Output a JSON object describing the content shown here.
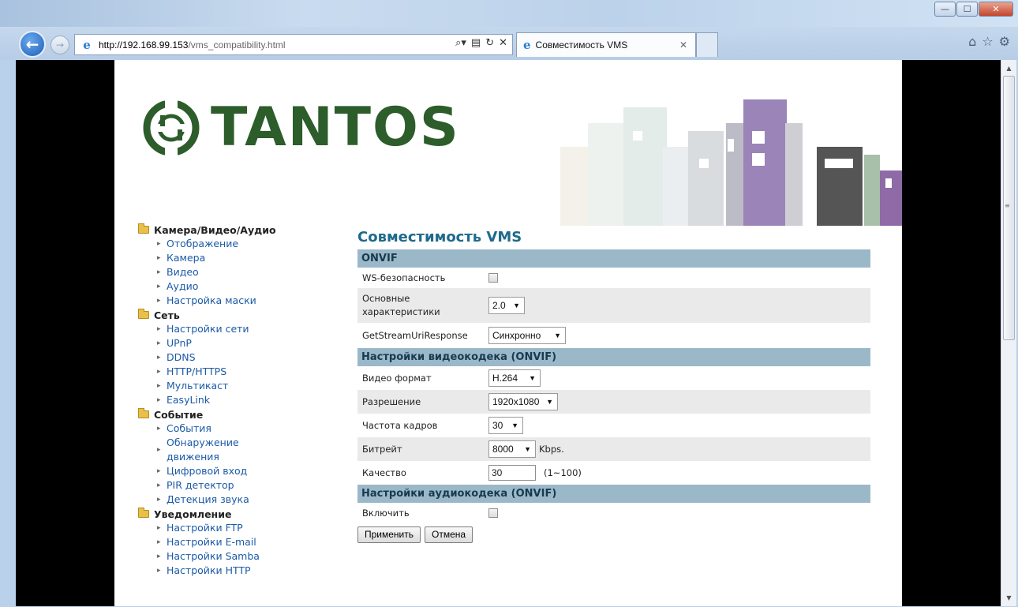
{
  "browser": {
    "url_host": "http://192.168.99.153",
    "url_path": "/vms_compatibility.html",
    "tab_title": "Совместимость VMS"
  },
  "brand": {
    "name": "TANTOS",
    "color": "#2c5d2a"
  },
  "sidebar": {
    "sections": [
      {
        "title": "Камера/Видео/Аудио",
        "items": [
          "Отображение",
          "Камера",
          "Видео",
          "Аудио",
          "Настройка маски"
        ]
      },
      {
        "title": "Сеть",
        "items": [
          "Настройки сети",
          "UPnP",
          "DDNS",
          "HTTP/HTTPS",
          "Мультикаст",
          "EasyLink"
        ]
      },
      {
        "title": "Событие",
        "items": [
          "События",
          "Обнаружение движения",
          "Цифровой вход",
          "PIR детектор",
          "Детекция звука"
        ]
      },
      {
        "title": "Уведомление",
        "items": [
          "Настройки FTP",
          "Настройки E-mail",
          "Настройки Samba",
          "Настройки HTTP"
        ]
      }
    ]
  },
  "page": {
    "title": "Совместимость VMS",
    "onvif": {
      "header": "ONVIF",
      "ws_security_label": "WS-безопасность",
      "main_features_label": "Основные характеристики",
      "main_features_value": "2.0",
      "getstream_label": "GetStreamUriResponse",
      "getstream_value": "Синхронно"
    },
    "video": {
      "header": "Настройки видеокодека (ONVIF)",
      "format_label": "Видео формат",
      "format_value": "H.264",
      "resolution_label": "Разрешение",
      "resolution_value": "1920x1080",
      "fps_label": "Частота кадров",
      "fps_value": "30",
      "bitrate_label": "Битрейт",
      "bitrate_value": "8000",
      "bitrate_unit": "Kbps.",
      "quality_label": "Качество",
      "quality_value": "30",
      "quality_range": "(1~100)"
    },
    "audio": {
      "header": "Настройки аудиокодека (ONVIF)",
      "enable_label": "Включить"
    },
    "apply_label": "Применить",
    "cancel_label": "Отмена"
  },
  "colors": {
    "section_header": "#9bb8c9",
    "title": "#1f6a8c",
    "link": "#1b5aa6"
  }
}
